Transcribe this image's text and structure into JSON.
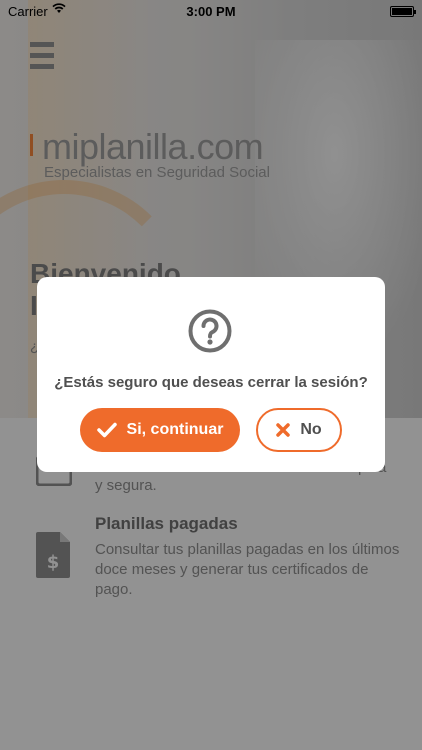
{
  "status_bar": {
    "carrier": "Carrier",
    "time": "3:00 PM"
  },
  "header": {
    "menu_icon": "hamburger-menu-icon",
    "brand": "miplanilla.com",
    "tagline": "Especialistas en Seguridad Social",
    "welcome": "Bienvenido",
    "welcome_second_line": "I",
    "welcome_sub": "¿"
  },
  "list": {
    "items": [
      {
        "icon": "card-icon",
        "title": "",
        "desc": "y segura.",
        "desc_right": "pida"
      },
      {
        "icon": "dollar-document-icon",
        "title": "Planillas pagadas",
        "desc": "Consultar tus planillas pagadas en los últimos doce meses y generar tus certificados de pago."
      }
    ]
  },
  "dialog": {
    "icon": "question-circle-icon",
    "message": "¿Estás seguro que deseas cerrar la sesión?",
    "confirm_label": "Si, continuar",
    "confirm_icon": "checkmark-icon",
    "cancel_label": "No",
    "cancel_icon": "x-icon",
    "accent_color": "#ef6b2b"
  }
}
